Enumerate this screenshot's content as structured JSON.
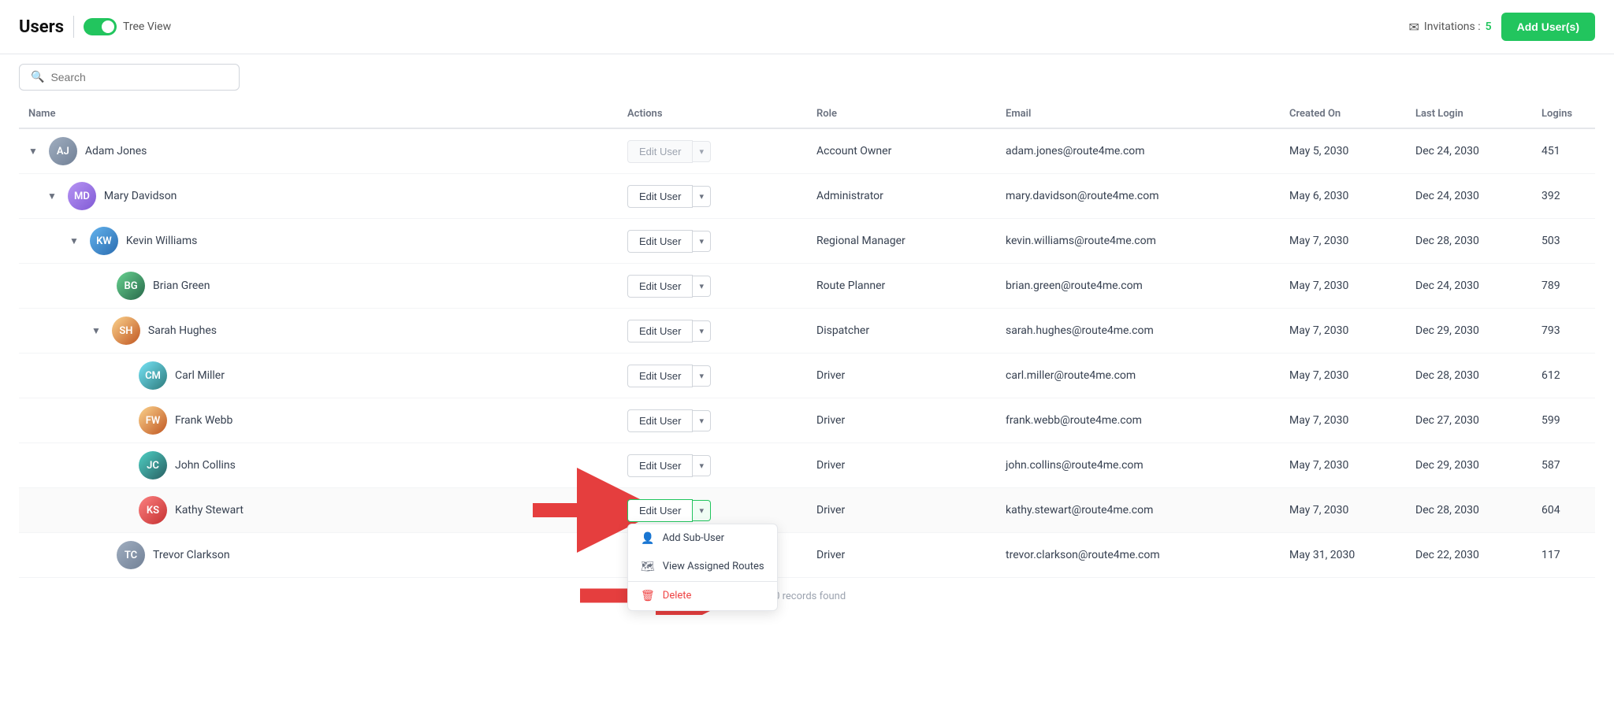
{
  "header": {
    "title": "Users",
    "toggle_label": "Tree View",
    "invitations_label": "Invitations :",
    "invitations_count": "5",
    "add_users_btn": "Add User(s)"
  },
  "search": {
    "placeholder": "Search"
  },
  "columns": {
    "name": "Name",
    "actions": "Actions",
    "role": "Role",
    "email": "Email",
    "created_on": "Created On",
    "last_login": "Last Login",
    "logins": "Logins"
  },
  "users": [
    {
      "id": 1,
      "indent": 0,
      "has_chevron": true,
      "name": "Adam Jones",
      "avatar_initials": "AJ",
      "avatar_color": "av-gray",
      "actions_disabled": true,
      "role": "Account Owner",
      "email": "adam.jones@route4me.com",
      "created_on": "May 5, 2030",
      "last_login": "Dec 24, 2030",
      "logins": "451"
    },
    {
      "id": 2,
      "indent": 1,
      "has_chevron": true,
      "name": "Mary Davidson",
      "avatar_initials": "MD",
      "avatar_color": "av-purple",
      "actions_disabled": false,
      "role": "Administrator",
      "email": "mary.davidson@route4me.com",
      "created_on": "May 6, 2030",
      "last_login": "Dec 24, 2030",
      "logins": "392"
    },
    {
      "id": 3,
      "indent": 2,
      "has_chevron": true,
      "name": "Kevin Williams",
      "avatar_initials": "KW",
      "avatar_color": "av-blue",
      "actions_disabled": false,
      "role": "Regional Manager",
      "email": "kevin.williams@route4me.com",
      "created_on": "May 7, 2030",
      "last_login": "Dec 28, 2030",
      "logins": "503"
    },
    {
      "id": 4,
      "indent": 3,
      "has_chevron": false,
      "name": "Brian Green",
      "avatar_initials": "BG",
      "avatar_color": "av-green",
      "actions_disabled": false,
      "role": "Route Planner",
      "email": "brian.green@route4me.com",
      "created_on": "May 7, 2030",
      "last_login": "Dec 24, 2030",
      "logins": "789"
    },
    {
      "id": 5,
      "indent": 3,
      "has_chevron": true,
      "name": "Sarah Hughes",
      "avatar_initials": "SH",
      "avatar_color": "av-orange",
      "actions_disabled": false,
      "role": "Dispatcher",
      "email": "sarah.hughes@route4me.com",
      "created_on": "May 7, 2030",
      "last_login": "Dec 29, 2030",
      "logins": "793"
    },
    {
      "id": 6,
      "indent": 4,
      "has_chevron": false,
      "name": "Carl Miller",
      "avatar_initials": "CM",
      "avatar_color": "av-indigo",
      "actions_disabled": false,
      "role": "Driver",
      "email": "carl.miller@route4me.com",
      "created_on": "May 7, 2030",
      "last_login": "Dec 28, 2030",
      "logins": "612"
    },
    {
      "id": 7,
      "indent": 4,
      "has_chevron": false,
      "name": "Frank Webb",
      "avatar_initials": "FW",
      "avatar_color": "av-orange",
      "actions_disabled": false,
      "role": "Driver",
      "email": "frank.webb@route4me.com",
      "created_on": "May 7, 2030",
      "last_login": "Dec 27, 2030",
      "logins": "599"
    },
    {
      "id": 8,
      "indent": 4,
      "has_chevron": false,
      "name": "John Collins",
      "avatar_initials": "JC",
      "avatar_color": "av-teal",
      "actions_disabled": false,
      "role": "Driver",
      "email": "john.collins@route4me.com",
      "created_on": "May 7, 2030",
      "last_login": "Dec 29, 2030",
      "logins": "587"
    },
    {
      "id": 9,
      "indent": 4,
      "has_chevron": false,
      "name": "Kathy Stewart",
      "avatar_initials": "KS",
      "avatar_color": "av-red",
      "actions_disabled": false,
      "dropdown_open": true,
      "role": "Driver",
      "email": "kathy.stewart@route4me.com",
      "created_on": "May 7, 2030",
      "last_login": "Dec 28, 2030",
      "logins": "604"
    },
    {
      "id": 10,
      "indent": 3,
      "has_chevron": false,
      "name": "Trevor Clarkson",
      "avatar_initials": "TC",
      "avatar_color": "av-gray",
      "actions_disabled": false,
      "role": "Driver",
      "email": "trevor.clarkson@route4me.com",
      "created_on": "May 31, 2030",
      "last_login": "Dec 22, 2030",
      "logins": "117"
    }
  ],
  "dropdown_menu": {
    "add_sub_user": "Add Sub-User",
    "view_assigned_routes": "View Assigned Routes",
    "delete": "Delete"
  },
  "edit_user_label": "Edit User",
  "footer": "10 records found"
}
